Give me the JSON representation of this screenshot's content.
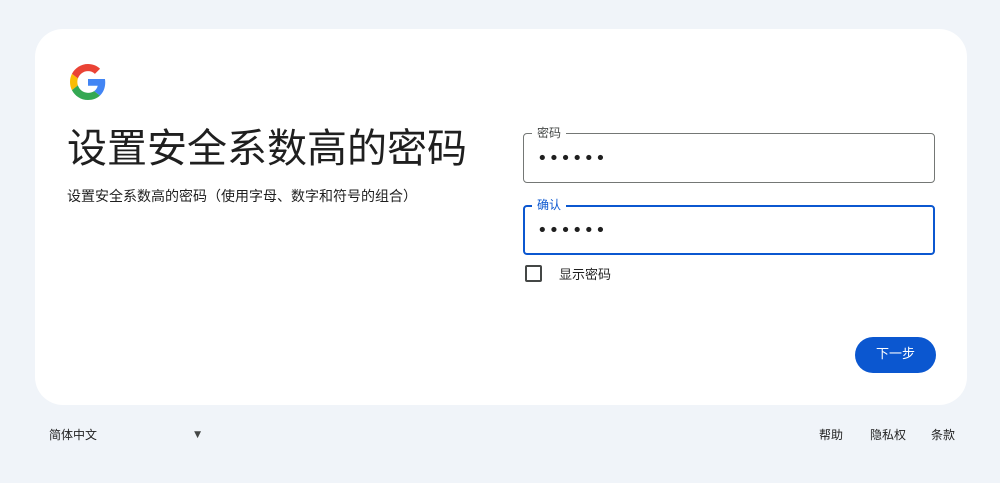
{
  "brand": {
    "logo_icon": "google-g-logo-icon",
    "colors": {
      "blue": "#4285F4",
      "red": "#EA4335",
      "yellow": "#FBBC05",
      "green": "#34A853"
    }
  },
  "heading": {
    "title": "设置安全系数高的密码",
    "subtitle": "设置安全系数高的密码（使用字母、数字和符号的组合）"
  },
  "form": {
    "password_label": "密码",
    "password_value": "••••••",
    "confirm_label": "确认",
    "confirm_value": "••••••",
    "show_password_label": "显示密码",
    "show_password_checked": false,
    "next_button": "下一步"
  },
  "footer": {
    "language": "简体中文",
    "language_icon": "caret-down-icon",
    "links": [
      "帮助",
      "隐私权",
      "条款"
    ]
  },
  "theme": {
    "accent": "#0b57d0",
    "page_background": "#f0f4f9",
    "card_background": "#ffffff"
  }
}
